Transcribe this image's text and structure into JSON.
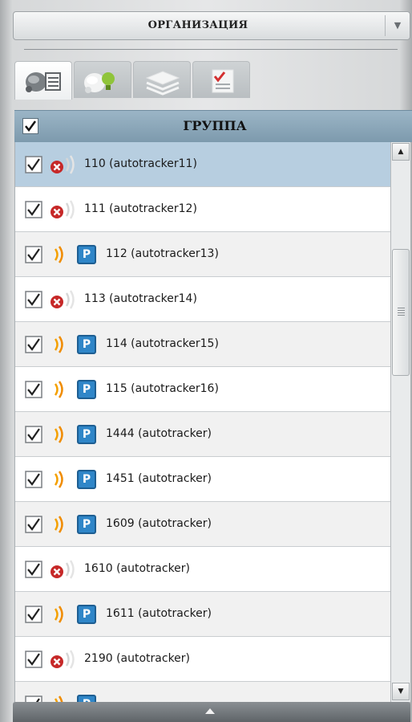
{
  "organization": {
    "label": "ОРГАНИЗАЦИЯ",
    "arrow": "▼"
  },
  "tabs": [
    {
      "name": "tab-units-list",
      "icon": "units-list-icon",
      "active": true
    },
    {
      "name": "tab-units-geofence",
      "icon": "units-bulb-icon",
      "active": false
    },
    {
      "name": "tab-layers",
      "icon": "layers-icon",
      "active": false
    },
    {
      "name": "tab-tasks",
      "icon": "checklist-icon",
      "active": false
    }
  ],
  "group": {
    "label": "ГРУППА",
    "checked": true
  },
  "rows": [
    {
      "label": "110 (autotracker11)",
      "status": "offline",
      "parking": false,
      "selected": true
    },
    {
      "label": "111 (autotracker12)",
      "status": "offline",
      "parking": false
    },
    {
      "label": "112 (autotracker13)",
      "status": "online",
      "parking": true
    },
    {
      "label": "113 (autotracker14)",
      "status": "offline",
      "parking": false
    },
    {
      "label": "114 (autotracker15)",
      "status": "online",
      "parking": true
    },
    {
      "label": "115 (autotracker16)",
      "status": "online",
      "parking": true
    },
    {
      "label": "1444 (autotracker)",
      "status": "online",
      "parking": true
    },
    {
      "label": "1451 (autotracker)",
      "status": "online",
      "parking": true
    },
    {
      "label": "1609 (autotracker)",
      "status": "online",
      "parking": true
    },
    {
      "label": "1610 (autotracker)",
      "status": "offline",
      "parking": false
    },
    {
      "label": "1611 (autotracker)",
      "status": "online",
      "parking": true
    },
    {
      "label": "2190 (autotracker)",
      "status": "offline",
      "parking": false
    },
    {
      "label": "",
      "status": "online",
      "parking": true
    }
  ],
  "parking_letter": "P",
  "scroll": {
    "up": "▲",
    "down": "▼"
  }
}
